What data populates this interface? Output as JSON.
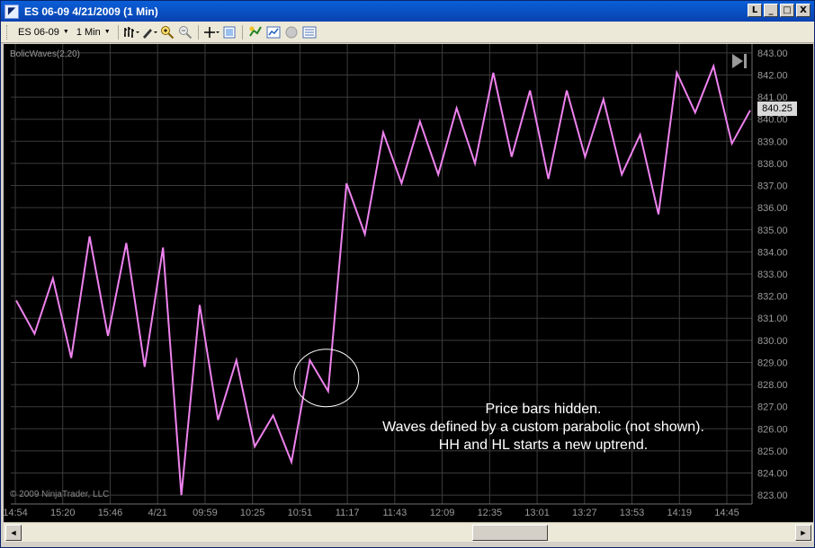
{
  "window": {
    "title": "ES 06-09  4/21/2009 (1 Min)",
    "buttons": {
      "help": "L",
      "minimize": "_",
      "maximize": "□",
      "close": "X"
    }
  },
  "toolbar": {
    "instrument": "ES 06-09",
    "interval": "1 Min",
    "icons": [
      "bar-type-icon",
      "draw-tool-icon",
      "zoom-in-icon",
      "zoom-out-icon",
      "crosshair-icon",
      "properties-icon",
      "strategy-icon",
      "chart-trader-icon",
      "record-icon",
      "data-box-icon"
    ]
  },
  "chart": {
    "indicator_label": "BolicWaves(2,20)",
    "copyright": "© 2009 NinjaTrader, LLC",
    "current_price": "840.25",
    "annotation_lines": [
      "Price bars hidden.",
      "Waves defined by a custom parabolic (not shown).",
      "HH and HL starts a new uptrend."
    ],
    "colors": {
      "background": "#000000",
      "grid": "#3c3c3c",
      "line": "#ee82ee",
      "axis_text": "#9a9a9a"
    }
  },
  "chart_data": {
    "type": "line",
    "series": [
      {
        "values": [
          831.8,
          830.3,
          832.8,
          829.2,
          834.7,
          830.2,
          834.4,
          828.8,
          834.2,
          823.0,
          831.6,
          826.4,
          829.1,
          825.2,
          826.6,
          824.5,
          829.1,
          827.7,
          837.1,
          834.8,
          839.4,
          837.1,
          839.9,
          837.5,
          840.5,
          838.0,
          842.1,
          838.3,
          841.3,
          837.3,
          841.3,
          838.3,
          840.9,
          837.5,
          839.3,
          835.7,
          842.1,
          840.3,
          842.4,
          838.9,
          840.4
        ]
      }
    ],
    "x_tick_labels": [
      "14:54",
      "15:20",
      "15:46",
      "4/21",
      "09:59",
      "10:25",
      "10:51",
      "11:17",
      "11:43",
      "12:09",
      "12:35",
      "13:01",
      "13:27",
      "13:53",
      "14:19",
      "14:45"
    ],
    "y_tick_labels": [
      "843.00",
      "842.00",
      "841.00",
      "840.00",
      "839.00",
      "838.00",
      "837.00",
      "836.00",
      "835.00",
      "834.00",
      "833.00",
      "832.00",
      "831.00",
      "830.00",
      "829.00",
      "828.00",
      "827.00",
      "826.00",
      "825.00",
      "824.00",
      "823.00"
    ],
    "ylim": [
      822.6,
      843.4
    ],
    "grid": true,
    "highlight_circle": {
      "center_index": 17,
      "center_price": 828.3
    }
  },
  "scrollbar": {
    "left_arrow": "◄",
    "right_arrow": "►"
  }
}
